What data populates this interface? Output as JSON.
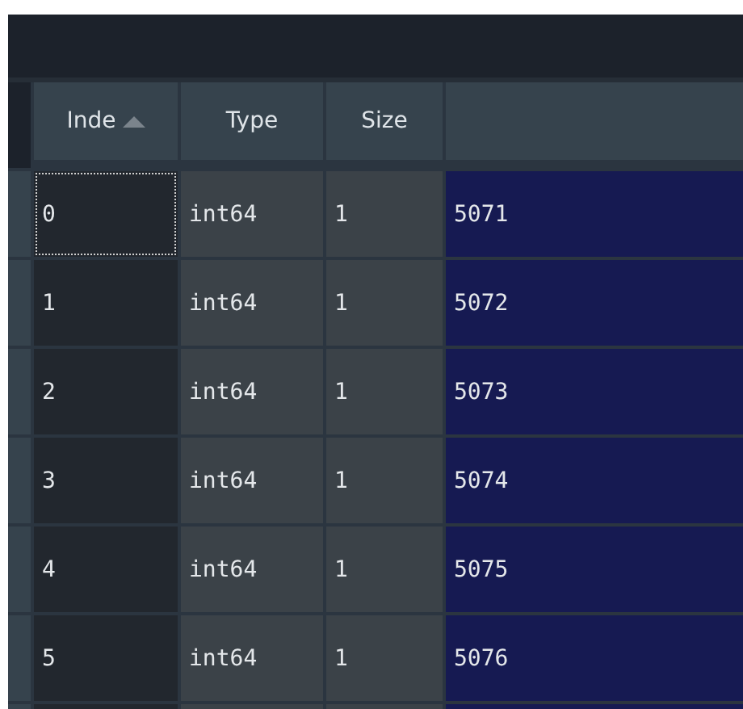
{
  "table": {
    "columns": [
      {
        "label": "Inde",
        "sorted": true
      },
      {
        "label": "Type",
        "sorted": false
      },
      {
        "label": "Size",
        "sorted": false
      },
      {
        "sorted": false
      }
    ],
    "rows": [
      {
        "index": "0",
        "type": "int64",
        "size": "1",
        "value": "5071",
        "focused": true
      },
      {
        "index": "1",
        "type": "int64",
        "size": "1",
        "value": "5072",
        "focused": false
      },
      {
        "index": "2",
        "type": "int64",
        "size": "1",
        "value": "5073",
        "focused": false
      },
      {
        "index": "3",
        "type": "int64",
        "size": "1",
        "value": "5074",
        "focused": false
      },
      {
        "index": "4",
        "type": "int64",
        "size": "1",
        "value": "5075",
        "focused": false
      },
      {
        "index": "5",
        "type": "int64",
        "size": "1",
        "value": "5076",
        "focused": false
      }
    ]
  }
}
